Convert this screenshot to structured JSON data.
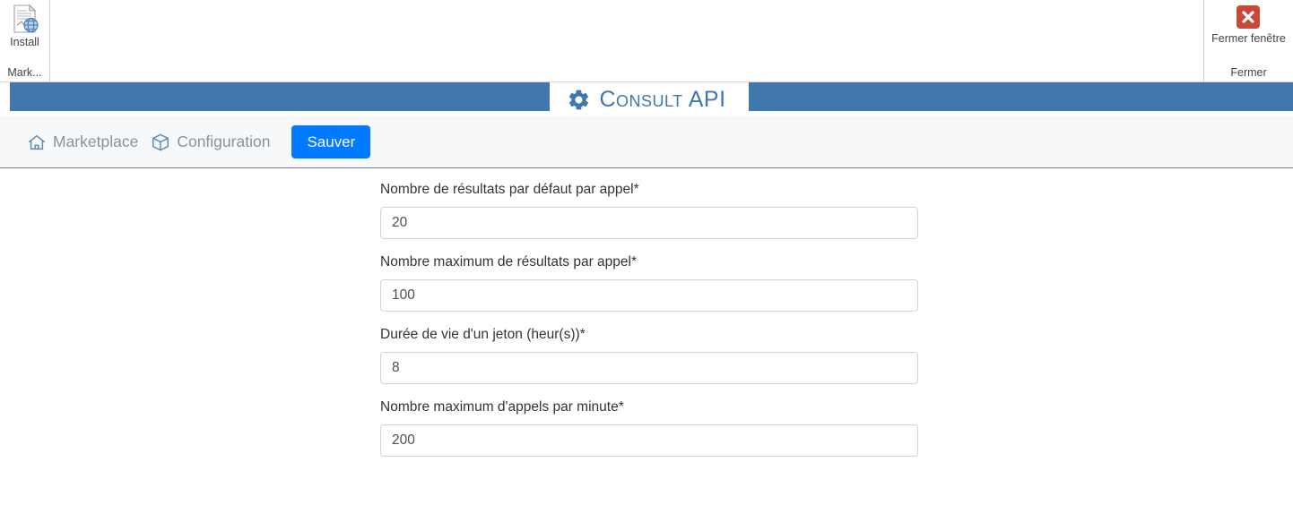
{
  "ribbon": {
    "left_group": {
      "button_label": "Install",
      "button_icon": "document-globe-icon",
      "group_label": "Mark..."
    },
    "right_group": {
      "button_label": "Fermer fenêtre",
      "button_icon": "close-window-icon",
      "group_label": "Fermer"
    }
  },
  "banner": {
    "title": "Consult API",
    "icon": "gear-icon",
    "bar_color": "#3f77ae",
    "title_color": "#3f77ae"
  },
  "navbar": {
    "links": [
      {
        "label": "Marketplace",
        "icon": "home-icon"
      },
      {
        "label": "Configuration",
        "icon": "box-icon"
      }
    ],
    "save_label": "Sauver",
    "save_color": "#007bff"
  },
  "form": {
    "fields": [
      {
        "label": "Nombre de résultats par défaut par appel*",
        "value": "20"
      },
      {
        "label": "Nombre maximum de résultats par appel*",
        "value": "100"
      },
      {
        "label": "Durée de vie d'un jeton (heur(s))*",
        "value": "8"
      },
      {
        "label": "Nombre maximum d'appels par minute*",
        "value": "200"
      }
    ]
  }
}
